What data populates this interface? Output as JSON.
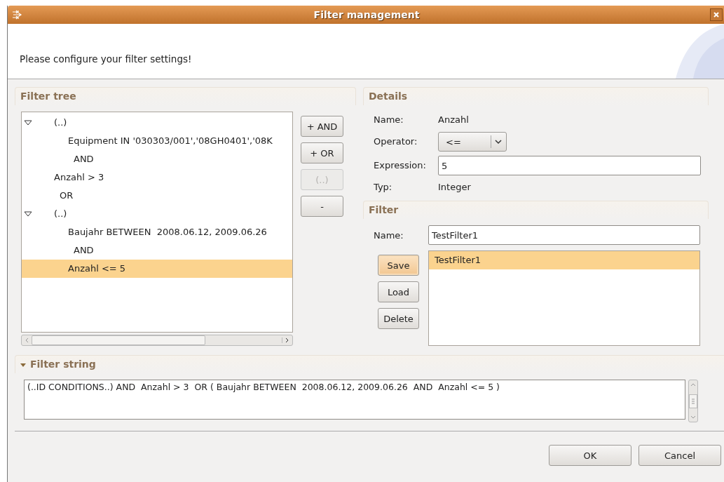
{
  "window": {
    "title": "Filter management",
    "message": "Please configure your filter settings!"
  },
  "filter_tree": {
    "title": "Filter tree",
    "items": [
      {
        "kind": "group",
        "text": "(..)",
        "expanded": true,
        "selected": false,
        "children": [
          {
            "kind": "condition",
            "text": "Equipment IN '030303/001','08GH0401','08K",
            "selected": false
          },
          {
            "kind": "operator",
            "text": "AND",
            "selected": false
          }
        ]
      },
      {
        "kind": "condition",
        "text": "Anzahl > 3",
        "selected": false
      },
      {
        "kind": "operator",
        "text": "OR",
        "selected": false
      },
      {
        "kind": "group",
        "text": "(..)",
        "expanded": true,
        "selected": false,
        "children": [
          {
            "kind": "condition",
            "text": "Baujahr BETWEEN  2008.06.12, 2009.06.26",
            "selected": false
          },
          {
            "kind": "operator",
            "text": "AND",
            "selected": false
          },
          {
            "kind": "condition",
            "text": "Anzahl <= 5",
            "selected": true
          }
        ]
      }
    ],
    "buttons": [
      {
        "label": "+ AND",
        "disabled": false
      },
      {
        "label": "+ OR",
        "disabled": false
      },
      {
        "label": "(..)",
        "disabled": true
      },
      {
        "label": "-",
        "disabled": false
      }
    ]
  },
  "details": {
    "title": "Details",
    "name_label": "Name:",
    "name_value": "Anzahl",
    "operator_label": "Operator:",
    "operator_value": "<=",
    "expression_label": "Expression:",
    "expression_value": "5",
    "type_label": "Typ:",
    "type_value": "Integer"
  },
  "filter": {
    "title": "Filter",
    "name_label": "Name:",
    "name_value": "TestFilter1",
    "buttons": [
      {
        "label": "Save",
        "focused": true
      },
      {
        "label": "Load",
        "focused": false
      },
      {
        "label": "Delete",
        "focused": false
      }
    ],
    "items": [
      {
        "text": "TestFilter1",
        "selected": true
      }
    ]
  },
  "filter_string": {
    "title": "Filter string",
    "expanded": true,
    "text": "(..ID CONDITIONS..) AND  Anzahl > 3  OR ( Baujahr BETWEEN  2008.06.12, 2009.06.26  AND  Anzahl <= 5 )"
  },
  "buttons": [
    {
      "label": "OK"
    },
    {
      "label": "Cancel"
    }
  ]
}
